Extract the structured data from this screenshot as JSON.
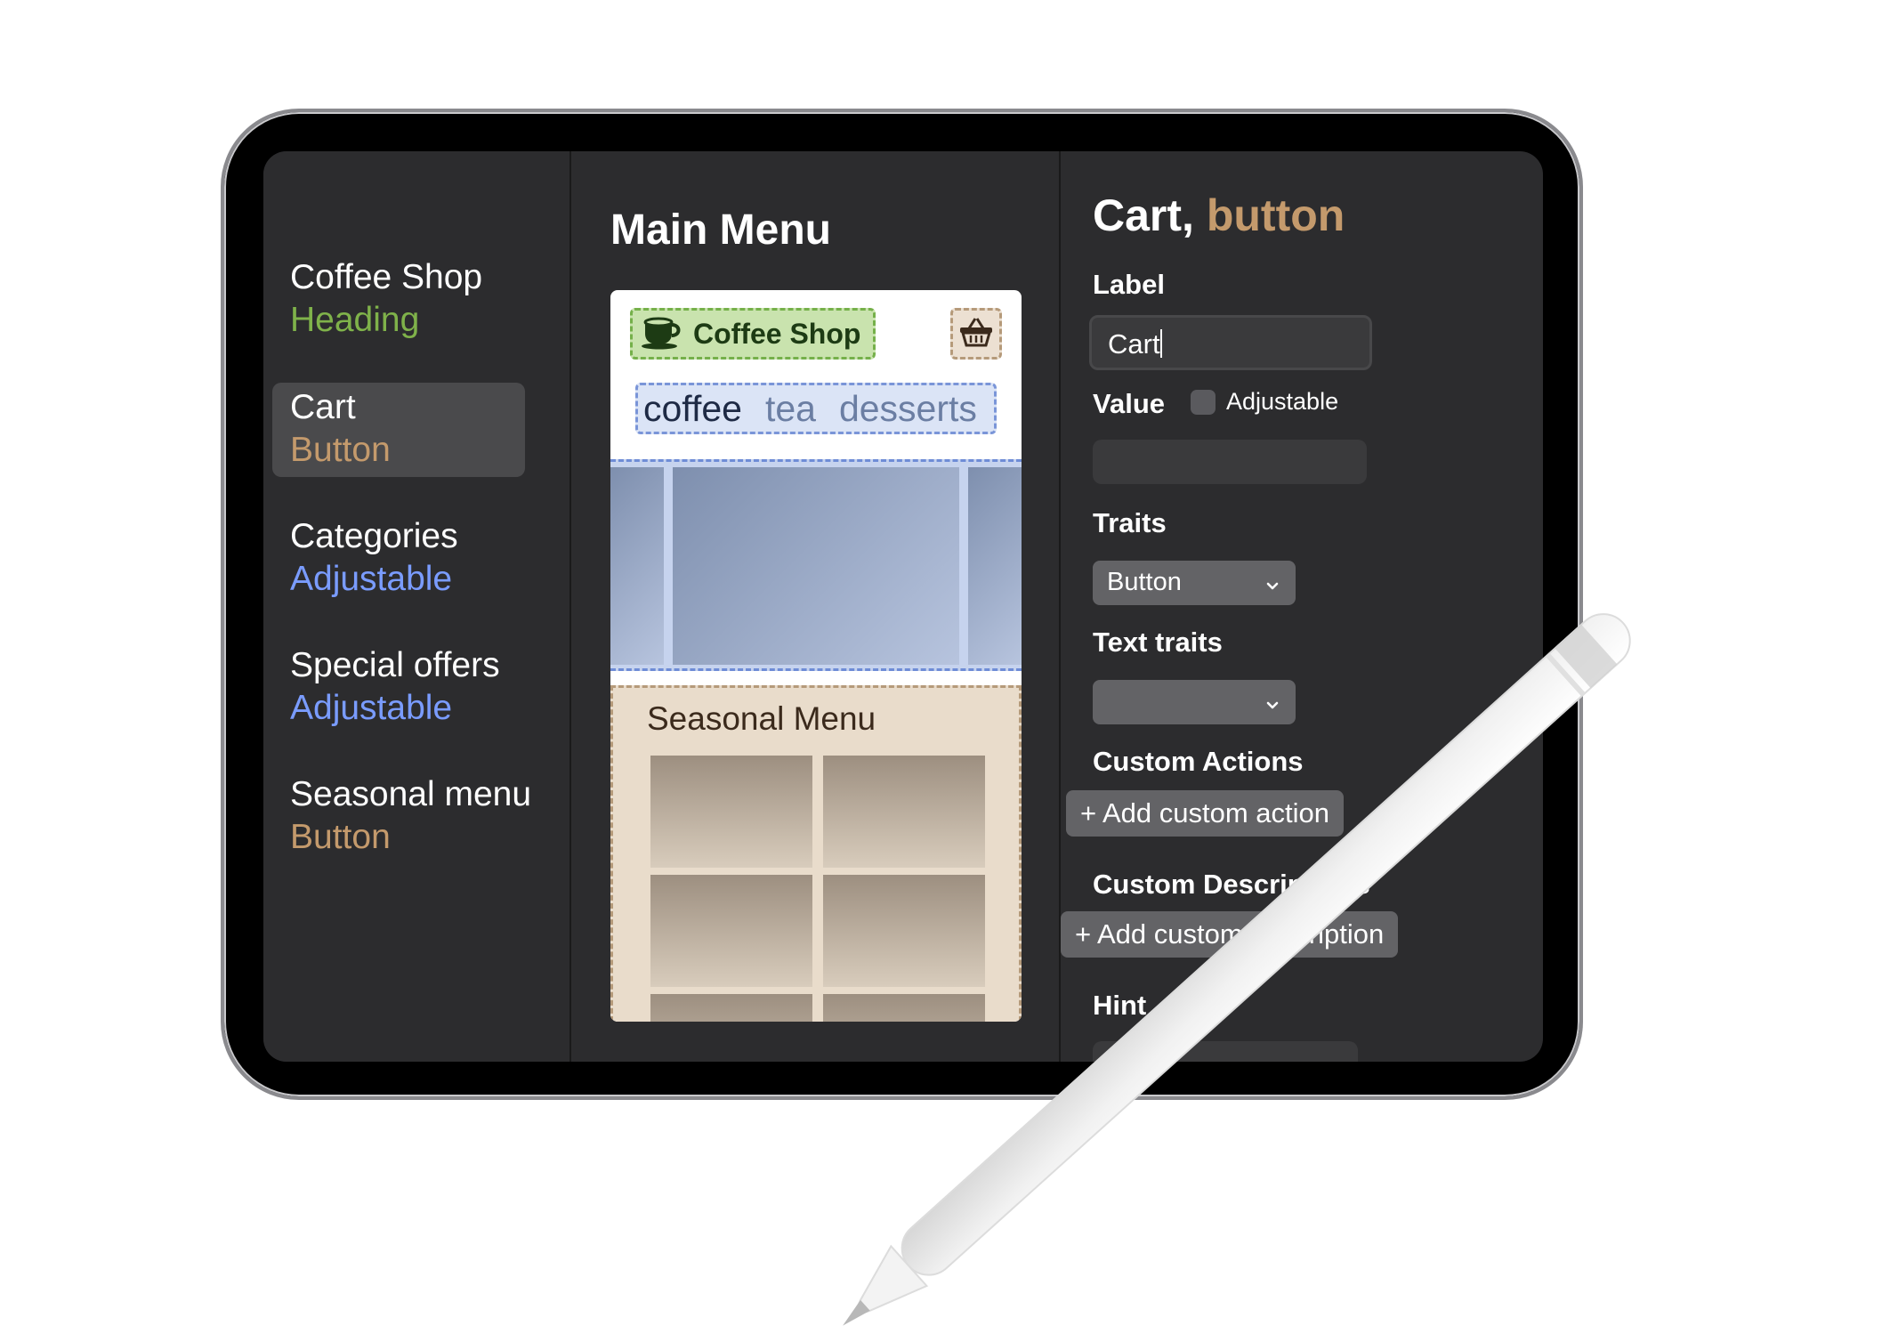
{
  "colors": {
    "heading_role": "#7fb24a",
    "button_role": "#c49a6c",
    "adjustable_role": "#7a9cff",
    "sidebar_bg": "#2c2c2e",
    "selected_bg": "#4a4a4c"
  },
  "sidebar": {
    "items": [
      {
        "title": "Coffee Shop",
        "role": "Heading",
        "role_color": "#7fb24a",
        "selected": false
      },
      {
        "title": "Cart",
        "role": "Button",
        "role_color": "#c49a6c",
        "selected": true
      },
      {
        "title": "Categories",
        "role": "Adjustable",
        "role_color": "#7a9cff",
        "selected": false
      },
      {
        "title": "Special offers",
        "role": "Adjustable",
        "role_color": "#7a9cff",
        "selected": false
      },
      {
        "title": "Seasonal menu",
        "role": "Button",
        "role_color": "#c49a6c",
        "selected": false
      }
    ]
  },
  "preview": {
    "title": "Main Menu",
    "heading": {
      "text": "Coffee Shop",
      "icon": "coffee-cup-icon"
    },
    "cart_icon": "basket-icon",
    "tabs": [
      "coffee",
      "tea",
      "desserts"
    ],
    "active_tab": "coffee",
    "seasonal_title": "Seasonal Menu"
  },
  "inspector": {
    "title_name": "Cart,",
    "title_role": "button",
    "label_heading": "Label",
    "label_value": "Cart",
    "value_heading": "Value",
    "adjustable_label": "Adjustable",
    "adjustable_checked": false,
    "value_field": "",
    "traits_heading": "Traits",
    "traits_selected": "Button",
    "text_traits_heading": "Text traits",
    "text_traits_selected": "",
    "custom_actions_heading": "Custom Actions",
    "add_action_label": "+ Add custom action",
    "custom_descriptions_heading": "Custom Descriptions",
    "add_description_label": "+ Add custom description",
    "hint_heading": "Hint"
  }
}
